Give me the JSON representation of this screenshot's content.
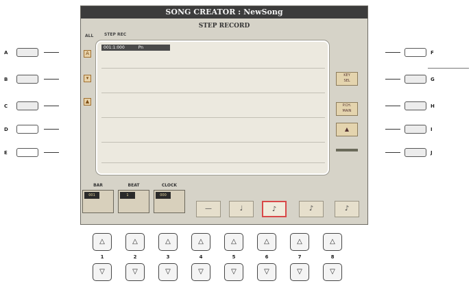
{
  "screen": {
    "title": "SONG CREATOR : NewSong",
    "subtitle": "STEP RECORD",
    "col_label_left": "ALL",
    "col_label_steprec": "STEP REC",
    "list_header": "001:1:000",
    "list_header_value": "Pn",
    "right_buttons": [
      {
        "label": "KEY\nSEL"
      },
      {
        "label": "P.CH.\nMAIN"
      },
      {
        "label": "▲"
      }
    ],
    "dials": [
      {
        "label": "BAR",
        "value": "001"
      },
      {
        "label": "BEAT",
        "value": "1"
      },
      {
        "label": "CLOCK",
        "value": "000"
      }
    ],
    "note_buttons": [
      "—",
      "♩",
      "♪",
      "♪",
      "♪"
    ]
  },
  "side_left": [
    "A",
    "B",
    "C",
    "D",
    "E"
  ],
  "side_right": [
    "F",
    "G",
    "H",
    "I",
    "J"
  ],
  "bottom_numbers": [
    "1",
    "2",
    "3",
    "4",
    "5",
    "6",
    "7",
    "8"
  ],
  "icons": {
    "up": "triangle-up-icon",
    "down": "triangle-down-icon"
  }
}
